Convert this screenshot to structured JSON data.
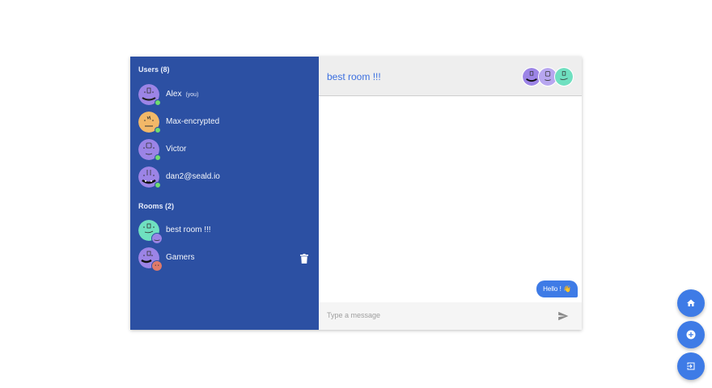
{
  "users_section": {
    "title": "Users (8)"
  },
  "users": [
    {
      "name": "Alex",
      "you_label": "(you)",
      "avatar_color": "#9c84e6"
    },
    {
      "name": "Max-encrypted",
      "avatar_color": "#f2b868"
    },
    {
      "name": "Victor",
      "avatar_color": "#9c84e6"
    },
    {
      "name": "dan2@seald.io",
      "avatar_color": "#9c84e6"
    }
  ],
  "rooms_section": {
    "title": "Rooms (2)"
  },
  "rooms": [
    {
      "name": "best room !!!",
      "avatar_color": "#6fe0c0",
      "mini_color": "#9c84e6"
    },
    {
      "name": "Gamers",
      "avatar_color": "#9c84e6",
      "mini_color": "#e07a6a"
    }
  ],
  "chat": {
    "room_title": "best room !!!",
    "header_avatar_colors": [
      "#9c84e6",
      "#b7a6f0",
      "#6fe0c0"
    ]
  },
  "messages": [
    {
      "text": "Hello ! 👋"
    }
  ],
  "composer": {
    "placeholder": "Type a message"
  },
  "colors": {
    "sidebar": "#2c50a3",
    "accent": "#3e7be6",
    "online": "#6fdc6f"
  },
  "fab_icons": [
    "home-icon",
    "plus-circle-icon",
    "logout-icon"
  ]
}
